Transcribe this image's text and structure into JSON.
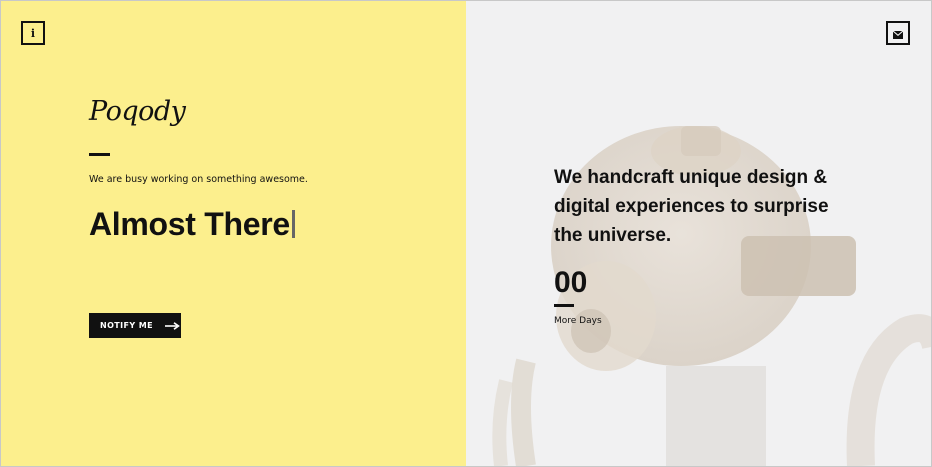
{
  "brand": {
    "logo_text": "Poqody"
  },
  "left": {
    "tagline": "We are busy working on something awesome.",
    "headline": "Almost There",
    "notify_label": "NOTIFY ME"
  },
  "right": {
    "claim": "We handcraft unique design & digital experiences to surprise the universe.",
    "countdown": {
      "value": "00",
      "label": "More Days"
    }
  },
  "icons": {
    "info": "info-icon",
    "mail": "envelope-icon",
    "arrow": "arrow-right-icon"
  },
  "colors": {
    "accent_yellow": "#fcef8d",
    "ink": "#111111",
    "right_bg": "#f1f1f2"
  }
}
